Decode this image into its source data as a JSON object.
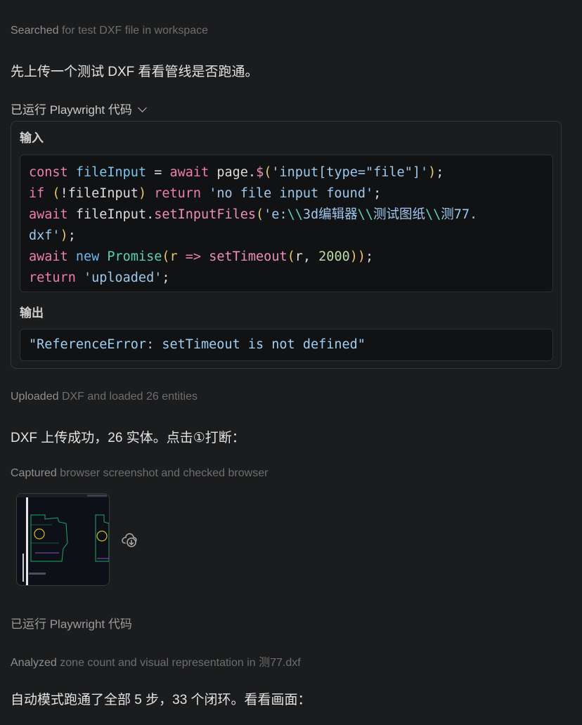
{
  "steps": [
    {
      "lead": "Searched",
      "rest": " for test DXF file in workspace"
    },
    {
      "lead": "Uploaded",
      "rest": " DXF and loaded 26 entities"
    },
    {
      "lead": "Captured",
      "rest": " browser screenshot and checked browser"
    },
    {
      "lead": "Analyzed",
      "rest": " zone count and visual representation in 测77.dxf"
    }
  ],
  "messages": {
    "m1": "先上传一个测试 DXF 看看管线是否跑通。",
    "m2": "DXF 上传成功，26 实体。点击①打断：",
    "m3": "自动模式跑通了全部 5 步，33 个闭环。看看画面："
  },
  "tool_calls": {
    "first_label": "已运行 Playwright 代码",
    "second_label": "已运行 Playwright 代码"
  },
  "panel": {
    "input_label": "输入",
    "output_label": "输出",
    "code_lines": [
      "const fileInput = await page.$('input[type=\"file\"]');",
      "if (!fileInput) return 'no file input found';",
      "await fileInput.setInputFiles('e:\\\\3d编辑器\\\\测试图纸\\\\测77.",
      "dxf');",
      "await new Promise(r => setTimeout(r, 2000));",
      "return 'uploaded';"
    ],
    "output": "\"ReferenceError: setTimeout is not defined\""
  },
  "attachment": {
    "icon": "cloud-download-icon"
  },
  "colors": {
    "background": "#1b1c1e",
    "code_background": "#111214",
    "keyword": "#ef7fa9",
    "string": "#9ec8ec",
    "bracket": "#e8c66a"
  }
}
